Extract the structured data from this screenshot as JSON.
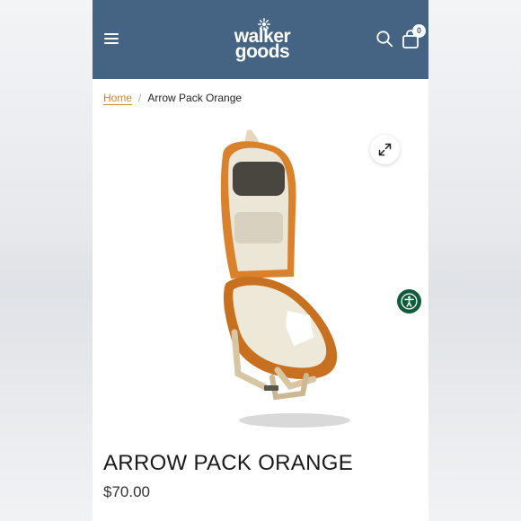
{
  "header": {
    "logo_line1": "walker",
    "logo_line2": "goods",
    "cart_count": "0",
    "background_color": "#456382"
  },
  "breadcrumb": {
    "home": "Home",
    "separator": "/",
    "current": "Arrow Pack Orange"
  },
  "product": {
    "image": "orange-backpack-open",
    "title": "ARROW PACK ORANGE",
    "price": "$70.00"
  },
  "icons": {
    "menu": "hamburger-icon",
    "search": "search-icon",
    "cart": "shopping-bag-icon",
    "zoom": "expand-icon",
    "accessibility": "accessibility-icon"
  },
  "colors": {
    "accent": "#c98c2e",
    "accessibility": "#0f5c3c"
  }
}
